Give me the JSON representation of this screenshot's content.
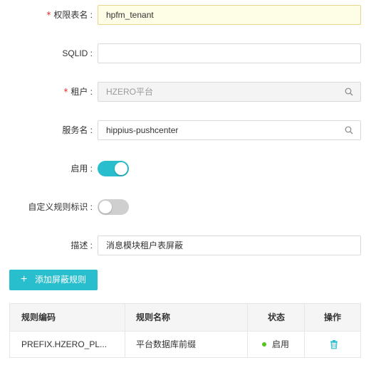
{
  "form": {
    "table_name": {
      "label": "权限表名 :",
      "required_mark": "*",
      "value": "hpfm_tenant"
    },
    "sqlid": {
      "label": "SQLID :",
      "value": ""
    },
    "tenant": {
      "label": "租户 :",
      "required_mark": "*",
      "value": "HZERO平台"
    },
    "service": {
      "label": "服务名 :",
      "value": "hippius-pushcenter"
    },
    "enabled": {
      "label": "启用 :",
      "on": true
    },
    "custom_rule": {
      "label": "自定义规则标识 :",
      "on": false
    },
    "description": {
      "label": "描述 :",
      "value": "消息模块租户表屏蔽"
    }
  },
  "add_button": {
    "label": "添加屏蔽规则",
    "icon": "plus-icon"
  },
  "table": {
    "headers": [
      "规则编码",
      "规则名称",
      "状态",
      "操作"
    ],
    "rows": [
      {
        "code": "PREFIX.HZERO_PL...",
        "name": "平台数据库前缀",
        "status": "启用",
        "action_icon": "trash-icon"
      }
    ]
  },
  "colors": {
    "accent": "#29bece",
    "status_on": "#52c41a",
    "required": "#e8281b"
  }
}
